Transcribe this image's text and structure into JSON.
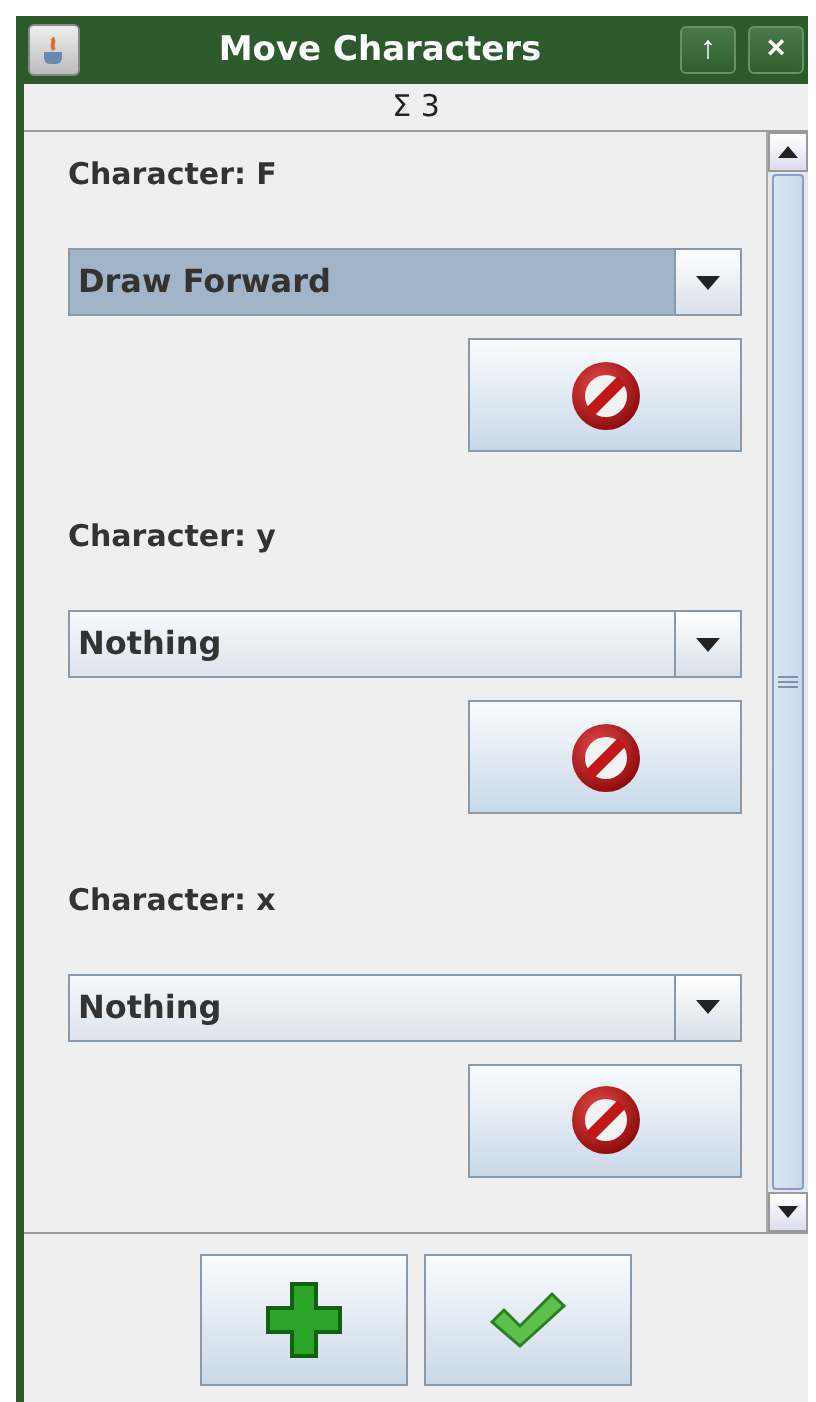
{
  "window": {
    "title": "Move Characters",
    "buttons": [
      "↑",
      "×"
    ]
  },
  "count": "Σ 3",
  "characters": [
    {
      "label": "Character: F",
      "action": "Draw Forward",
      "focused": true
    },
    {
      "label": "Character: y",
      "action": "Nothing",
      "focused": false
    },
    {
      "label": "Character: x",
      "action": "Nothing",
      "focused": false
    }
  ]
}
